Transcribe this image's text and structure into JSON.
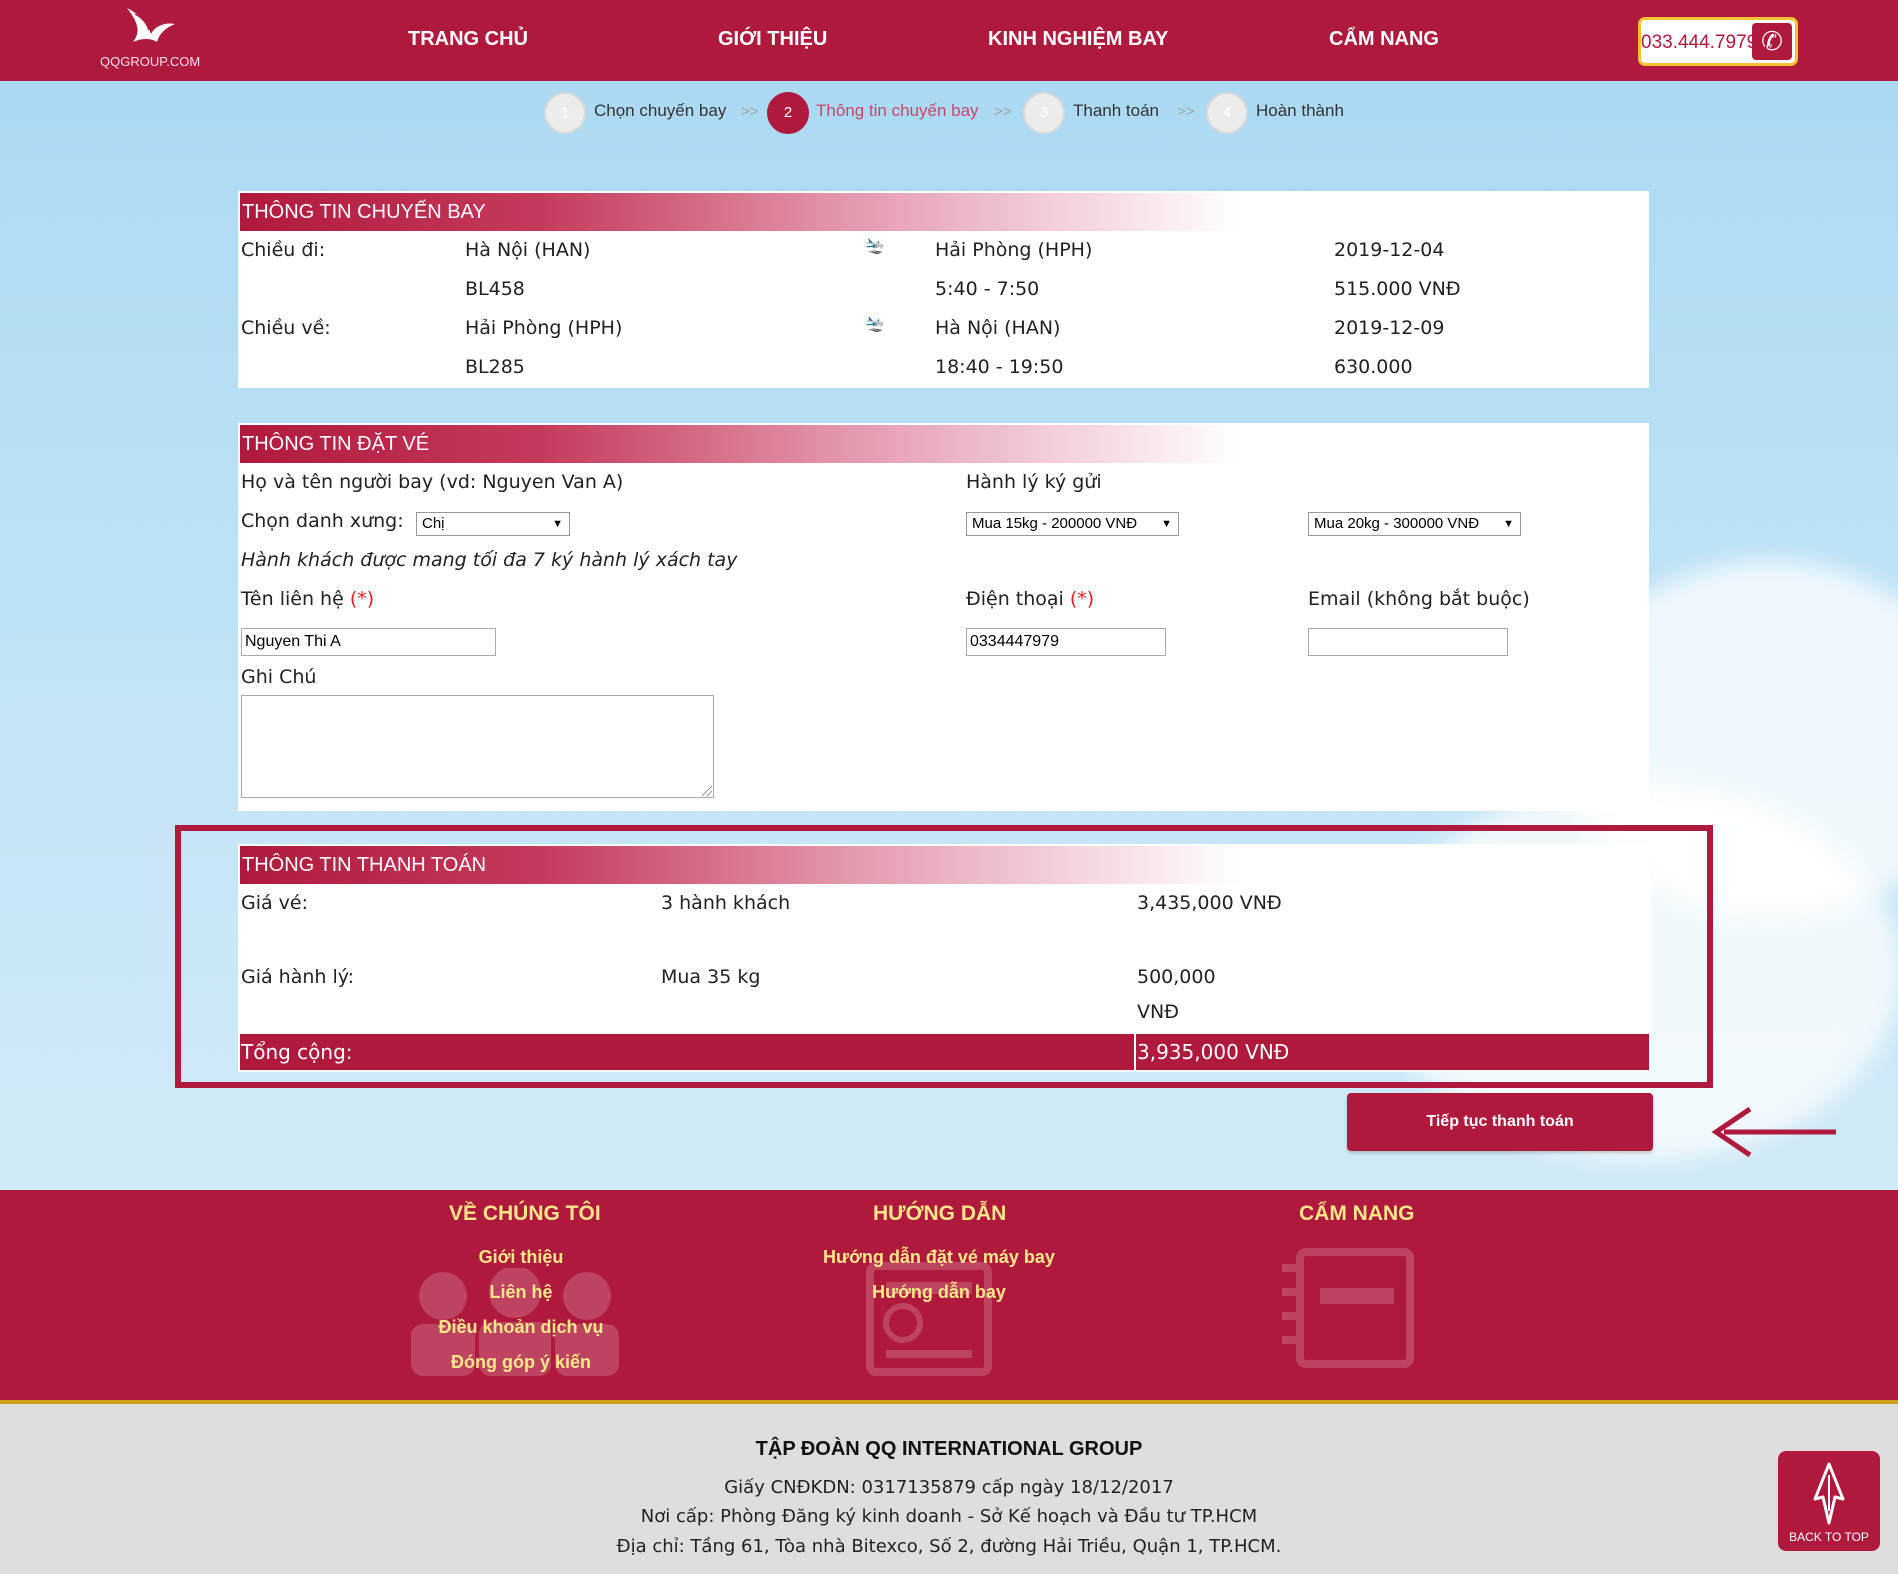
{
  "header": {
    "logo_text": "QQGROUP.COM",
    "nav": [
      "TRANG CHỦ",
      "GIỚI THIỆU",
      "KINH NGHIỆM BAY",
      "CẨM NANG"
    ],
    "phone": "033.444.7979"
  },
  "steps": [
    {
      "num": "1",
      "label": "Chọn chuyến bay",
      "active": false
    },
    {
      "num": "2",
      "label": "Thông tin chuyến bay",
      "active": true
    },
    {
      "num": "3",
      "label": "Thanh toán",
      "active": false
    },
    {
      "num": "4",
      "label": "Hoàn thành",
      "active": false
    }
  ],
  "step_separator": ">>",
  "flight_info": {
    "title": "THÔNG TIN CHUYẾN BAY",
    "outbound": {
      "label": "Chiều đi:",
      "from": "Hà Nội (HAN)",
      "to": "Hải Phòng (HPH)",
      "date": "2019-12-04",
      "flight_no": "BL458",
      "time": "5:40 - 7:50",
      "price": "515.000 VNĐ"
    },
    "return": {
      "label": "Chiều về:",
      "from": "Hải Phòng (HPH)",
      "to": "Hà Nội (HAN)",
      "date": "2019-12-09",
      "flight_no": "BL285",
      "time": "18:40 - 19:50",
      "price": "630.000"
    }
  },
  "booking": {
    "title": "THÔNG TIN ĐẶT VÉ",
    "passenger_name_label": "Họ và tên người bay (vd: Nguyen Van A)",
    "title_label": "Chọn danh xưng:",
    "title_value": "Chị",
    "hand_luggage_note": "Hành khách được mang tối đa 7 ký hành lý xách tay",
    "baggage_label": "Hành lý ký gửi",
    "baggage_1": "Mua 15kg - 200000 VNĐ",
    "baggage_2": "Mua 20kg - 300000 VNĐ",
    "contact_label": "Tên liên hệ",
    "contact_value": "Nguyen Thi A",
    "phone_label": "Điện thoại",
    "phone_value": "0334447979",
    "email_label": "Email (không bắt buộc)",
    "email_value": "",
    "required_mark": "(*)",
    "note_label": "Ghi Chú",
    "note_value": ""
  },
  "payment": {
    "title": "THÔNG TIN THANH TOÁN",
    "ticket_label": "Giá vé:",
    "ticket_qty": "3 hành khách",
    "ticket_price": "3,435,000 VNĐ",
    "baggage_label": "Giá hành lý:",
    "baggage_qty": "Mua 35 kg",
    "baggage_price_1": "500,000",
    "baggage_price_2": "VNĐ",
    "total_label": "Tổng cộng:",
    "total_value": "3,935,000 VNĐ"
  },
  "continue_button": "Tiếp tục thanh toán",
  "footer": {
    "about_heading": "VỀ CHÚNG TÔI",
    "about_links": [
      "Giới thiệu",
      "Liên hệ",
      "Điều khoản dịch vụ",
      "Đóng góp ý kiến"
    ],
    "guide_heading": "HƯỚNG DẪN",
    "guide_links": [
      "Hướng dẫn đặt vé máy bay",
      "Hướng dẫn bay"
    ],
    "handbook_heading": "CẨM NANG",
    "company": "TẬP ĐOÀN QQ INTERNATIONAL GROUP",
    "license": "Giấy CNĐKDN: 0317135879 cấp ngày 18/12/2017",
    "issuer": "Nơi cấp: Phòng Đăng ký kinh doanh - Sở Kế hoạch và Đầu tư TP.HCM",
    "address": "Địa chỉ: Tầng 61, Tòa nhà Bitexco, Số 2, đường Hải Triều, Quận 1, TP.HCM."
  },
  "back_to_top": "BACK TO TOP",
  "colors": {
    "brand": "#b0193e",
    "footer_text": "#fde68a",
    "gold": "#d4a017"
  }
}
